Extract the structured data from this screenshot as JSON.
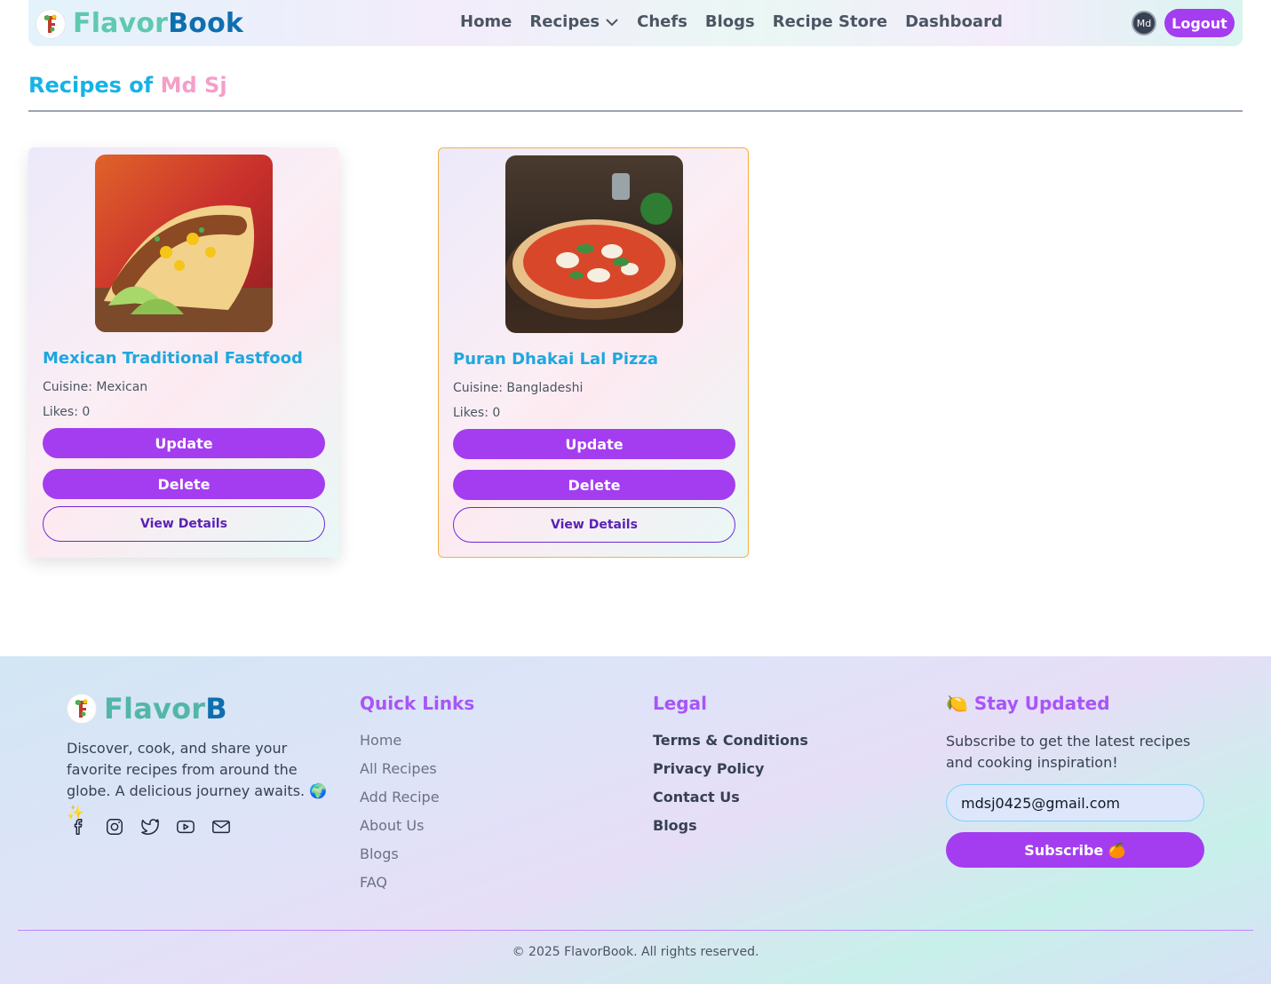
{
  "brand": {
    "part1": "Flavor",
    "part2": "Book"
  },
  "nav": {
    "links": [
      {
        "label": "Home"
      },
      {
        "label": "Recipes"
      },
      {
        "label": "Chefs"
      },
      {
        "label": "Blogs"
      },
      {
        "label": "Recipe Store"
      },
      {
        "label": "Dashboard"
      }
    ],
    "avatar_text": "Md",
    "logout_label": "Logout"
  },
  "heading": {
    "prefix": "Recipes of",
    "user": "Md Sj"
  },
  "recipes": [
    {
      "title": "Mexican Traditional Fastfood",
      "cuisine": "Cuisine: Mexican",
      "likes": "Likes: 0",
      "update_label": "Update",
      "delete_label": "Delete",
      "details_label": "View Details",
      "image": "tacos-photo"
    },
    {
      "title": "Puran Dhakai Lal Pizza",
      "cuisine": "Cuisine: Bangladeshi",
      "likes": "Likes: 0",
      "update_label": "Update",
      "delete_label": "Delete",
      "details_label": "View Details",
      "image": "pizza-photo"
    }
  ],
  "footer": {
    "brand": {
      "part1": "Flavor",
      "part2": "B"
    },
    "description": "Discover, cook, and share your favorite recipes from around the globe. A delicious journey awaits. 🌍✨",
    "socials": [
      "facebook-icon",
      "instagram-icon",
      "twitter-icon",
      "youtube-icon",
      "mail-icon"
    ],
    "quick_links": {
      "title": "Quick Links",
      "items": [
        "Home",
        "All Recipes",
        "Add Recipe",
        "About Us",
        "Blogs",
        "FAQ"
      ]
    },
    "legal": {
      "title": "Legal",
      "items": [
        "Terms & Conditions",
        "Privacy Policy",
        "Contact Us",
        "Blogs"
      ]
    },
    "newsletter": {
      "title": "🍋 Stay Updated",
      "text": "Subscribe to get the latest recipes and cooking inspiration!",
      "email_value": "mdsj0425@gmail.com",
      "button_label": "Subscribe 🍊"
    },
    "copyright": "© 2025 FlavorBook. All rights reserved."
  },
  "colors": {
    "accent": "#a43df0",
    "title_blue": "#16b3e6",
    "user_pink": "#f59ec8"
  }
}
